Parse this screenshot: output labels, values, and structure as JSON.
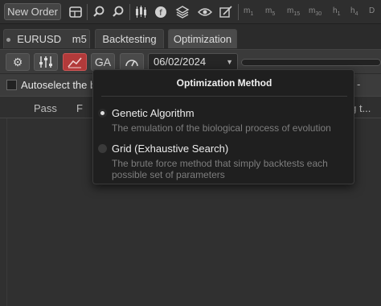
{
  "toolbar": {
    "new_order_label": "New Order",
    "timeframes": [
      {
        "main": "m",
        "sub": "1"
      },
      {
        "main": "m",
        "sub": "5"
      },
      {
        "main": "m",
        "sub": "15"
      },
      {
        "main": "m",
        "sub": "30"
      },
      {
        "main": "h",
        "sub": "1"
      },
      {
        "main": "h",
        "sub": "4"
      },
      {
        "main": "D",
        "sub": ""
      }
    ]
  },
  "tabs": {
    "symbol": "EURUSD",
    "timeframe": "m5",
    "backtesting": "Backtesting",
    "optimization": "Optimization"
  },
  "controls": {
    "ga_label": "GA",
    "date_value": "06/02/2024",
    "date_caret": "▼"
  },
  "content": {
    "autoselect_label": "Autoselect the be",
    "autoselect_suffix": "-",
    "col_pass": "Pass",
    "col_f": "F",
    "col_trailing": "ing t..."
  },
  "popup": {
    "title": "Optimization Method",
    "options": [
      {
        "label": "Genetic Algorithm",
        "description": "The emulation of the biological process of evolution",
        "selected": true
      },
      {
        "label": "Grid (Exhaustive Search)",
        "description": "The brute force method that simply backtests each possible set of parameters",
        "selected": false
      }
    ]
  },
  "colors": {
    "accent_red": "#b23a3a",
    "popup_bg": "#1f1f1f",
    "panel_bg": "#303030"
  }
}
